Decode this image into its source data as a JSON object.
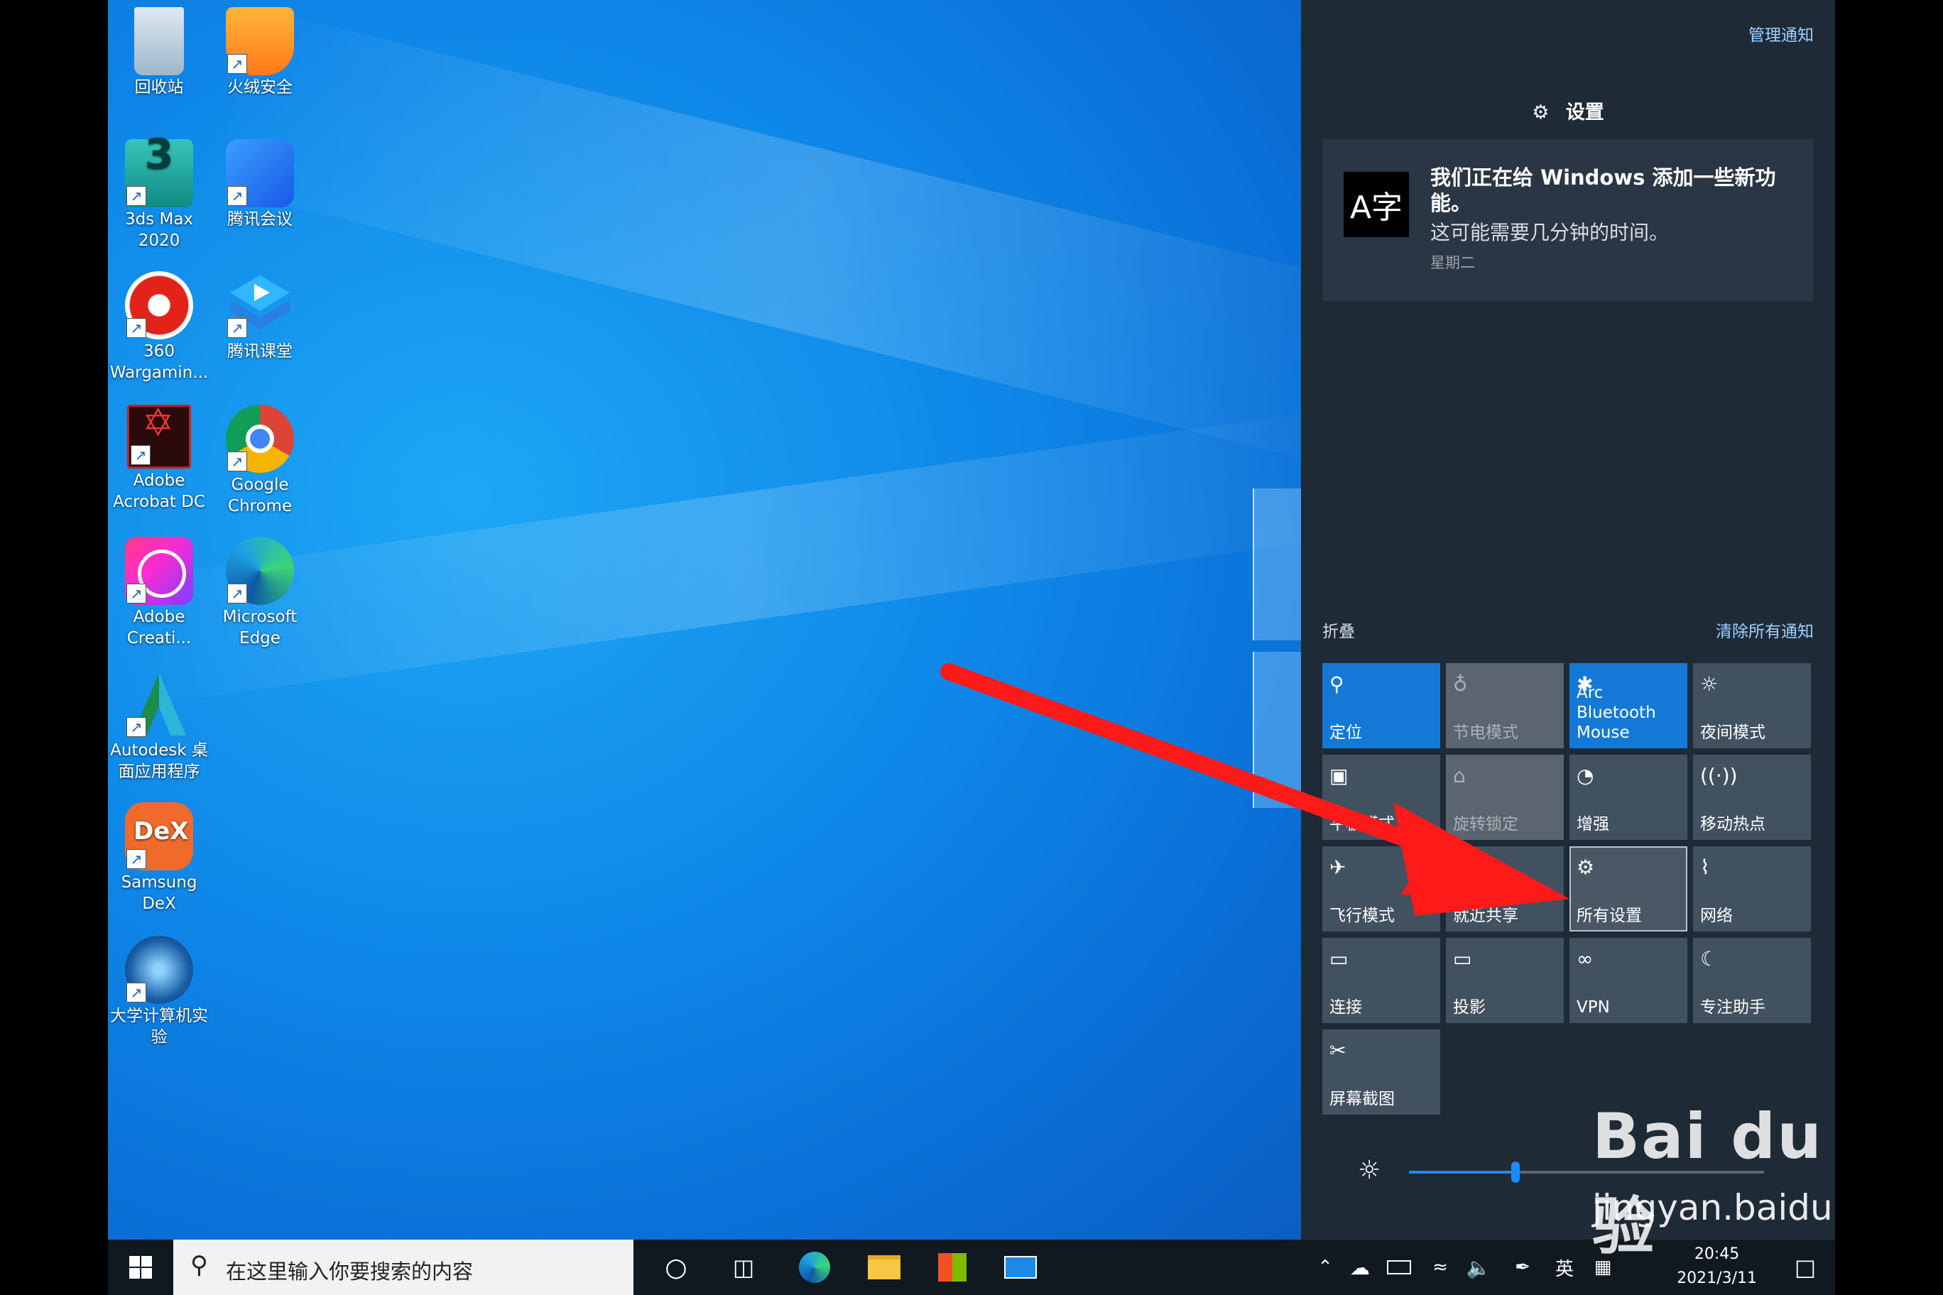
{
  "desktop": {
    "icons": [
      {
        "label": "回收站"
      },
      {
        "label": "火绒安全"
      },
      {
        "label": "3ds Max 2020"
      },
      {
        "label": "腾讯会议"
      },
      {
        "label": "360 Wargamin..."
      },
      {
        "label": "腾讯课堂"
      },
      {
        "label": "Adobe Acrobat DC"
      },
      {
        "label": "Google Chrome"
      },
      {
        "label": "Adobe Creati..."
      },
      {
        "label": "Microsoft Edge"
      },
      {
        "label": "Autodesk 桌面应用程序"
      },
      {
        "label": "Samsung DeX"
      },
      {
        "label": "大学计算机实验"
      }
    ]
  },
  "action_center": {
    "manage_notifications": "管理通知",
    "group_title": "设置",
    "notification": {
      "title": "我们正在给 Windows 添加一些新功能。",
      "body": "这可能需要几分钟的时间。",
      "time": "星期二",
      "icon_text": "A字"
    },
    "collapse": "折叠",
    "clear_all": "清除所有通知",
    "tiles": [
      {
        "label": "定位",
        "icon": "location-icon",
        "state": "on"
      },
      {
        "label": "节电模式",
        "icon": "battery-saver-icon",
        "state": "dim"
      },
      {
        "label": "Arc Bluetooth Mouse",
        "icon": "bluetooth-icon",
        "state": "on"
      },
      {
        "label": "夜间模式",
        "icon": "night-light-icon",
        "state": "off"
      },
      {
        "label": "平板模式",
        "icon": "tablet-mode-icon",
        "state": "off"
      },
      {
        "label": "旋转锁定",
        "icon": "rotation-lock-icon",
        "state": "dim"
      },
      {
        "label": "增强",
        "icon": "enhance-icon",
        "state": "off"
      },
      {
        "label": "移动热点",
        "icon": "hotspot-icon",
        "state": "off"
      },
      {
        "label": "飞行模式",
        "icon": "airplane-icon",
        "state": "off"
      },
      {
        "label": "就近共享",
        "icon": "nearby-share-icon",
        "state": "off"
      },
      {
        "label": "所有设置",
        "icon": "settings-icon",
        "state": "selected"
      },
      {
        "label": "网络",
        "icon": "network-icon",
        "state": "off"
      },
      {
        "label": "连接",
        "icon": "connect-icon",
        "state": "off"
      },
      {
        "label": "投影",
        "icon": "project-icon",
        "state": "off"
      },
      {
        "label": "VPN",
        "icon": "vpn-icon",
        "state": "off"
      },
      {
        "label": "专注助手",
        "icon": "focus-assist-icon",
        "state": "off"
      },
      {
        "label": "屏幕截图",
        "icon": "snip-icon",
        "state": "off"
      }
    ],
    "brightness_percent": 30
  },
  "taskbar": {
    "search_placeholder": "在这里输入你要搜索的内容",
    "ime_lang": "英",
    "time": "20:45",
    "date": "2021/3/11"
  },
  "watermark": {
    "brand": "Bai du 经验",
    "url": "jingyan.baidu.com"
  },
  "colors": {
    "desktop_blue": "#0e87e8",
    "action_center_bg": "#1f2a37",
    "tile_on": "#1479d6",
    "tile_off": "#425160",
    "annotation_red": "#ff1a1a"
  }
}
